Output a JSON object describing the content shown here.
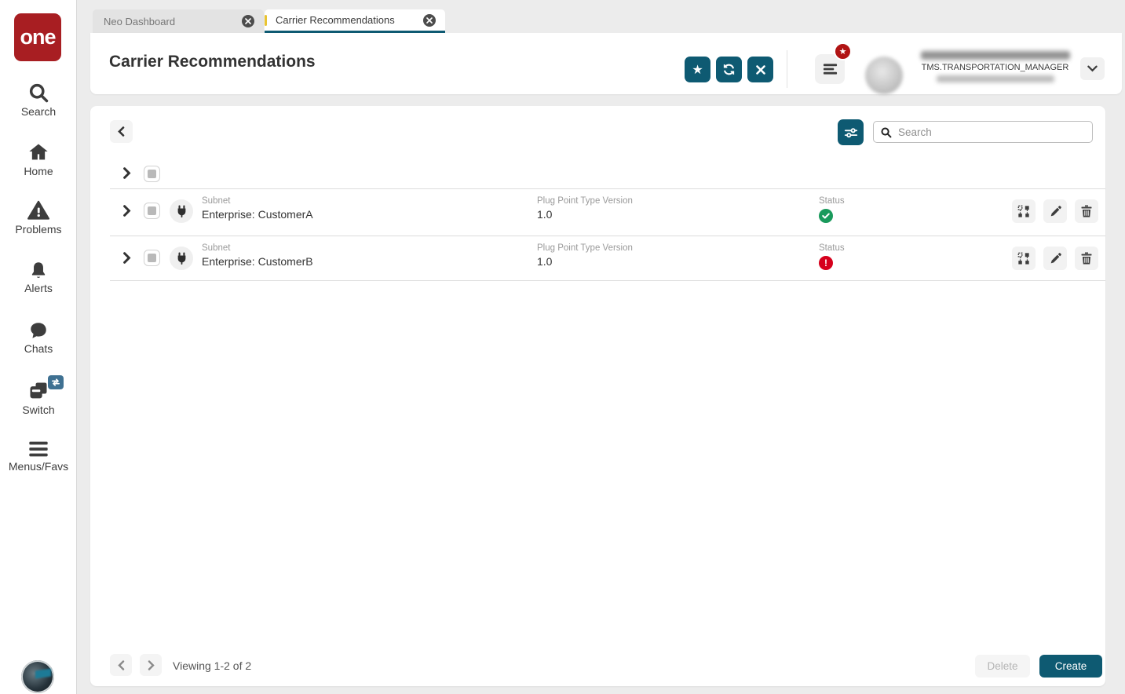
{
  "sidebar": {
    "logo_text": "one",
    "items": [
      {
        "label": "Search"
      },
      {
        "label": "Home"
      },
      {
        "label": "Problems"
      },
      {
        "label": "Alerts"
      },
      {
        "label": "Chats"
      },
      {
        "label": "Switch"
      },
      {
        "label": "Menus/Favs"
      }
    ]
  },
  "tabs": [
    {
      "label": "Neo Dashboard"
    },
    {
      "label": "Carrier Recommendations"
    }
  ],
  "header": {
    "title": "Carrier Recommendations",
    "user_role": "TMS.TRANSPORTATION_MANAGER"
  },
  "toolbar": {
    "search_placeholder": "Search"
  },
  "table": {
    "rows": [
      {
        "type_label": "Subnet",
        "name": "Enterprise: CustomerA",
        "version_label": "Plug Point Type Version",
        "version": "1.0",
        "status_label": "Status",
        "status": "ok"
      },
      {
        "type_label": "Subnet",
        "name": "Enterprise: CustomerB",
        "version_label": "Plug Point Type Version",
        "version": "1.0",
        "status_label": "Status",
        "status": "error"
      }
    ]
  },
  "footer": {
    "viewing": "Viewing 1-2 of 2",
    "delete_label": "Delete",
    "create_label": "Create"
  },
  "icons": {
    "favorite_star": "★",
    "status_error_mark": "!"
  },
  "colors": {
    "teal": "#0e5a72",
    "logo_red": "#a81e22",
    "badge_red": "#b11414",
    "status_ok": "#1a9a5c",
    "status_error": "#d6001c",
    "active_tab_accent": "#e9c431"
  }
}
